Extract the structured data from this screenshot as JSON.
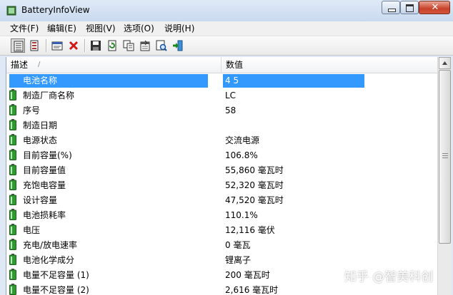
{
  "window": {
    "title": "BatteryInfoView"
  },
  "menu": [
    "文件(F)",
    "编辑(E)",
    "视图(V)",
    "选项(O)",
    "说明(H)"
  ],
  "columns": {
    "desc": "描述",
    "value": "数值",
    "sort_indicator": "/"
  },
  "rows": [
    {
      "desc": "电池名称",
      "value": "4 5",
      "selected": true
    },
    {
      "desc": "制造厂商名称",
      "value": "LC"
    },
    {
      "desc": "序号",
      "value": "58"
    },
    {
      "desc": "制造日期",
      "value": ""
    },
    {
      "desc": "电源状态",
      "value": "交流电源"
    },
    {
      "desc": "目前容量(%)",
      "value": "106.8%"
    },
    {
      "desc": "目前容量值",
      "value": "55,860 毫瓦时"
    },
    {
      "desc": "充饱电容量",
      "value": "52,320 毫瓦时"
    },
    {
      "desc": "设计容量",
      "value": "47,520 毫瓦时"
    },
    {
      "desc": "电池损耗率",
      "value": "110.1%"
    },
    {
      "desc": "电压",
      "value": "12,116 毫伏"
    },
    {
      "desc": "充电/放电速率",
      "value": "0 毫瓦"
    },
    {
      "desc": "电池化学成分",
      "value": "锂离子"
    },
    {
      "desc": "电量不足容量 (1)",
      "value": "200 毫瓦时"
    },
    {
      "desc": "电量不足容量 (2)",
      "value": "2,616 毫瓦时"
    }
  ],
  "watermark": "知乎 @智美科创",
  "colors": {
    "selection": "#3399ff",
    "battery": "#2e9b2e",
    "close_button": "#c8412b"
  },
  "icons": [
    "view-details-icon",
    "view-list-icon",
    "html-report-icon",
    "delete-icon",
    "save-icon",
    "refresh-icon",
    "copy-icon",
    "properties-icon",
    "find-icon",
    "exit-icon"
  ]
}
